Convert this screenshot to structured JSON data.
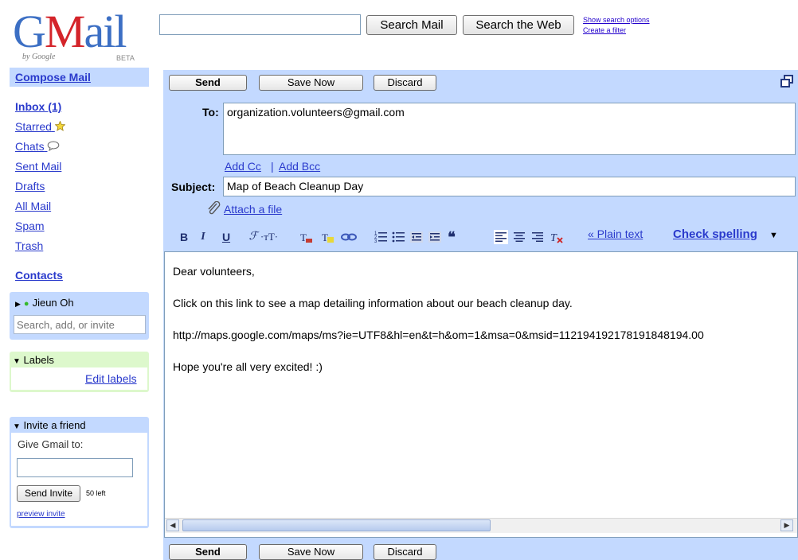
{
  "logo": {
    "text_g": "G",
    "text_m": "M",
    "text_rest": "ail",
    "byline": "by Google",
    "beta": "BETA"
  },
  "search": {
    "value": "",
    "search_mail_label": "Search Mail",
    "search_web_label": "Search the Web",
    "show_options_label": "Show search options",
    "create_filter_label": "Create a filter"
  },
  "nav": {
    "compose_label": "Compose Mail",
    "inbox_label": "Inbox (1)",
    "starred_label": "Starred",
    "chats_label": "Chats",
    "sent_label": "Sent Mail",
    "drafts_label": "Drafts",
    "all_label": "All Mail",
    "spam_label": "Spam",
    "trash_label": "Trash",
    "contacts_label": "Contacts"
  },
  "chat": {
    "user_name": "Jieun Oh",
    "status_color": "#35b92b",
    "search_placeholder": "Search, add, or invite"
  },
  "labels_box": {
    "title": "Labels",
    "edit_label": "Edit labels"
  },
  "invite": {
    "title": "Invite a friend",
    "give_label": "Give Gmail to:",
    "send_label": "Send Invite",
    "left_text": "50 left",
    "preview_label": "preview invite"
  },
  "compose": {
    "send_label": "Send",
    "save_label": "Save Now",
    "discard_label": "Discard",
    "to_label": "To:",
    "to_value": "organization.volunteers@gmail.com",
    "add_cc_label": "Add Cc",
    "cc_separator": "|",
    "add_bcc_label": "Add Bcc",
    "subject_label": "Subject:",
    "subject_value": "Map of Beach Cleanup Day",
    "attach_label": "Attach a file",
    "plain_text_label": "« Plain text",
    "check_spelling_label": "Check spelling",
    "body_lines": [
      "Dear volunteers,",
      "Click on this link to see a map detailing information about our beach cleanup day.",
      "http://maps.google.com/maps/ms?ie=UTF8&hl=en&t=h&om=1&msa=0&msid=112194192178191848194.00",
      "Hope you're all very excited! :)"
    ]
  },
  "toolbar": {
    "bold": "B",
    "italic": "I",
    "underline": "U",
    "font": "ℱ",
    "size": "·тT·",
    "quote": "❝"
  },
  "colors": {
    "accent_blue": "#c3d9ff",
    "link": "#2a3acc",
    "labels_green": "#ddf8cc"
  }
}
